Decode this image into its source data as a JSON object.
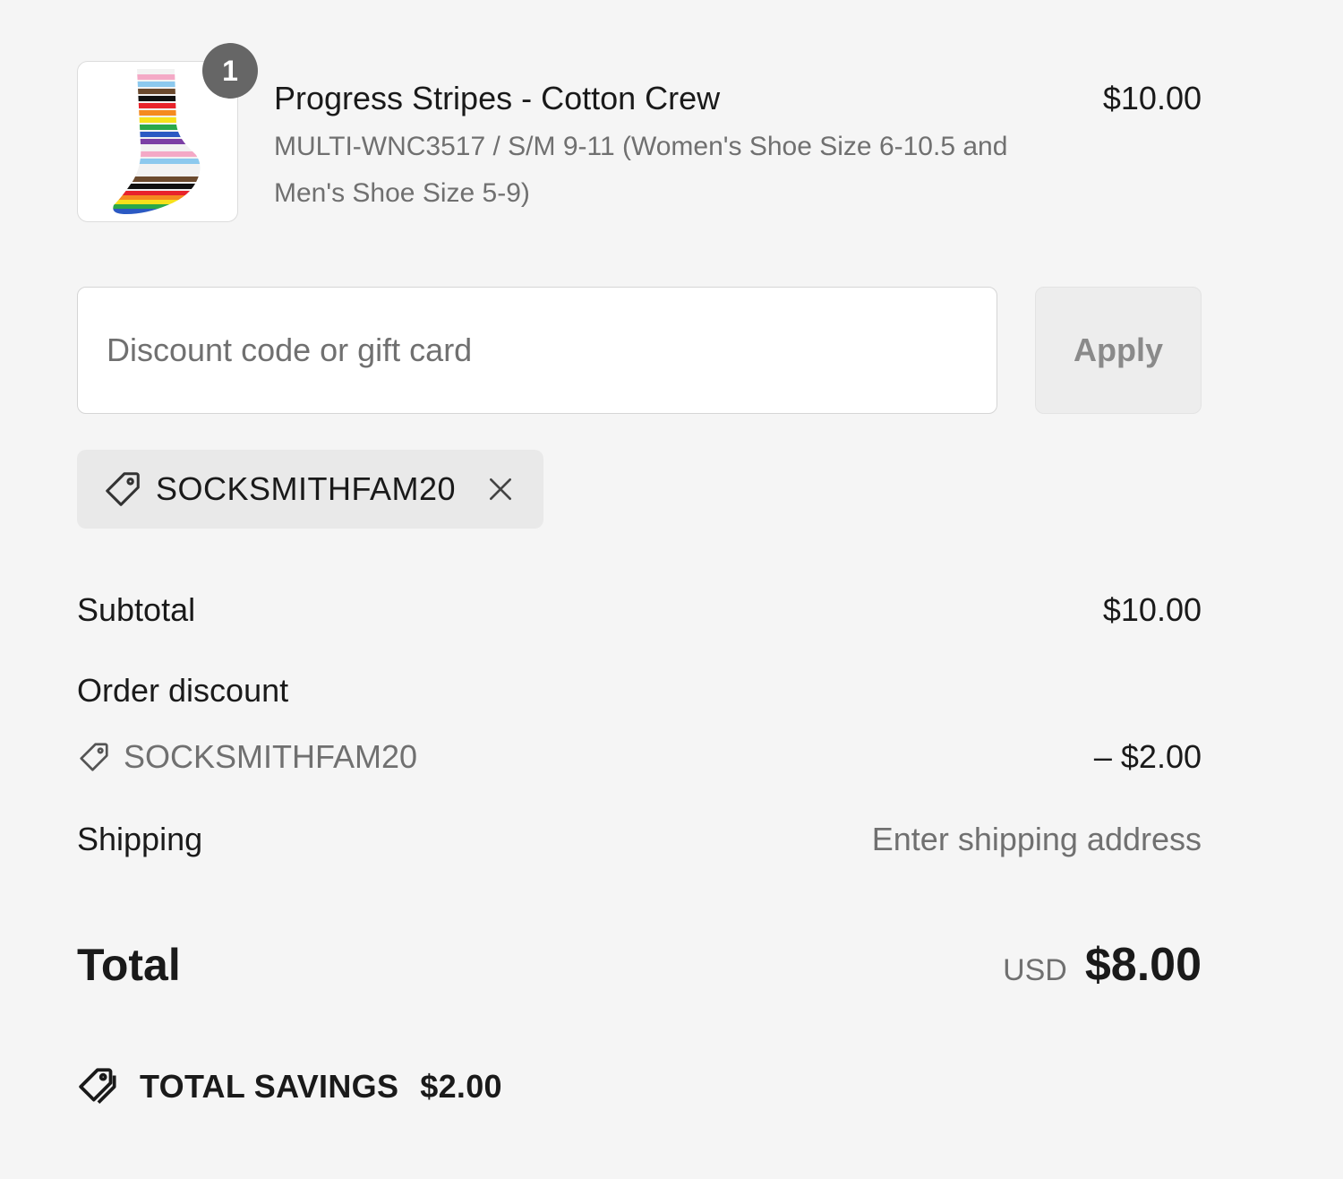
{
  "product": {
    "name": "Progress Stripes - Cotton Crew",
    "variant": "MULTI-WNC3517 / S/M 9-11 (Women's Shoe Size 6-10.5 and Men's Shoe Size 5-9)",
    "price": "$10.00",
    "quantity": "1",
    "image_icon": "rainbow-striped-crew-sock"
  },
  "discount_form": {
    "placeholder": "Discount code or gift card",
    "value": "",
    "apply_label": "Apply"
  },
  "applied_code": {
    "code": "SOCKSMITHFAM20",
    "icon": "tag-icon",
    "remove_icon": "close-icon"
  },
  "summary": {
    "subtotal_label": "Subtotal",
    "subtotal_value": "$10.00",
    "order_discount_label": "Order discount",
    "discount_code": "SOCKSMITHFAM20",
    "discount_value": "– $2.00",
    "shipping_label": "Shipping",
    "shipping_value": "Enter shipping address",
    "total_label": "Total",
    "currency": "USD",
    "total_value": "$8.00"
  },
  "savings": {
    "label": "TOTAL SAVINGS",
    "value": "$2.00",
    "icon": "double-tag-icon"
  },
  "colors": {
    "background": "#f5f5f5",
    "text": "#1a1a1a",
    "muted_text": "#707070",
    "badge": "#666666",
    "chip_background": "#e9e9e9",
    "apply_button_background": "#ededed"
  }
}
